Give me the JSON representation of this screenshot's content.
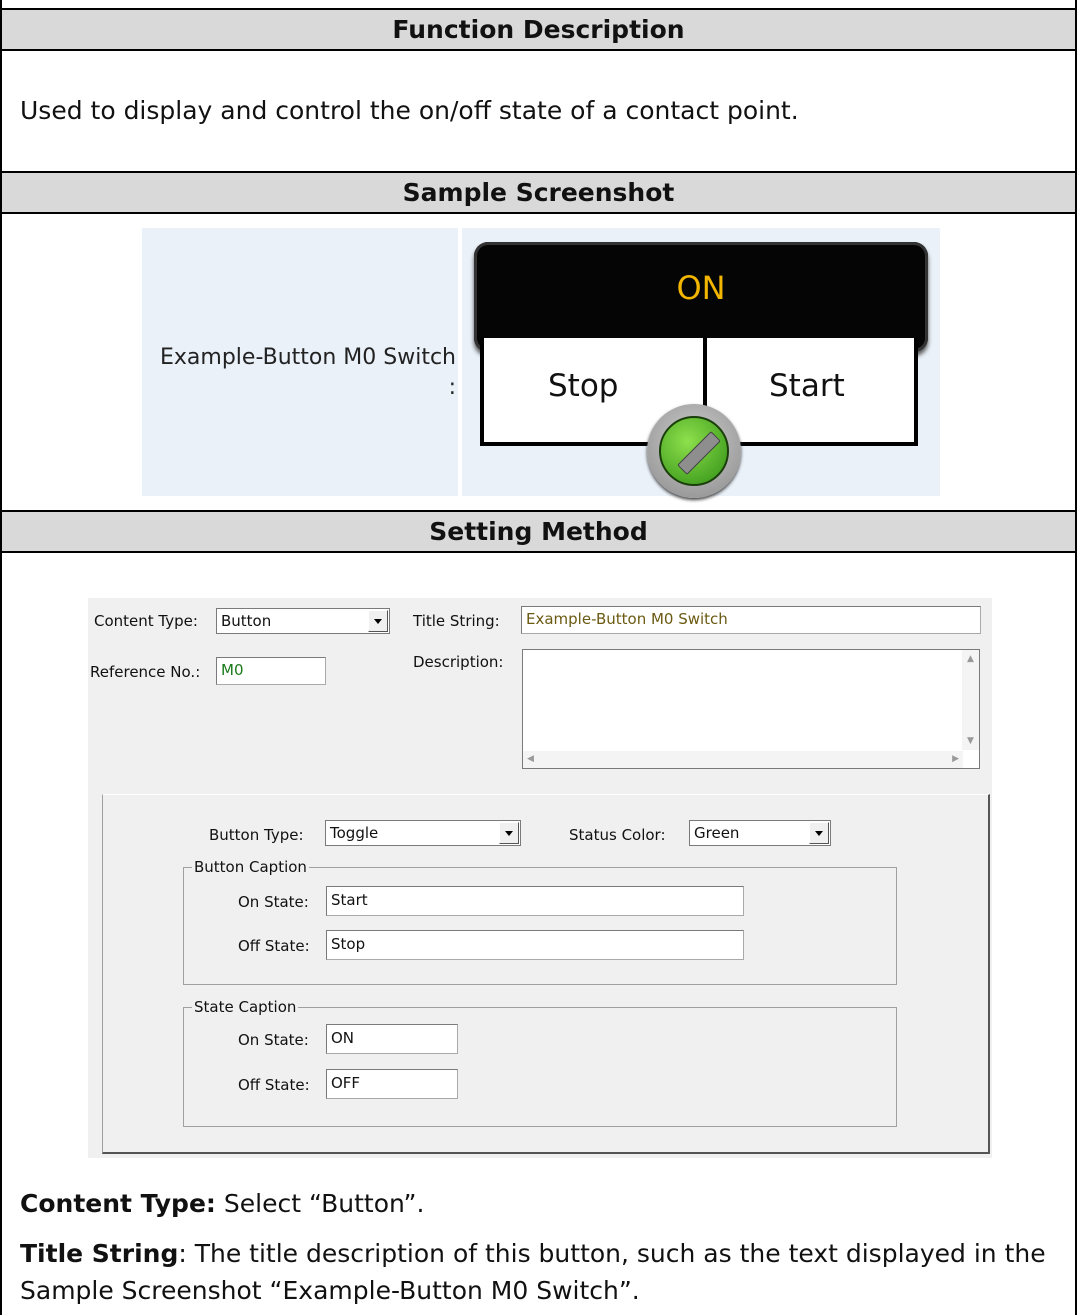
{
  "sections": {
    "function_header": "Function Description",
    "function_text": "Used to display and control the on/off state of a contact point.",
    "sample_header": "Sample Screenshot",
    "setting_header": "Setting Method"
  },
  "sample": {
    "label": "Example-Button M0 Switch",
    "colon": ":",
    "state_caption": "ON",
    "off_label": "Stop",
    "on_label": "Start",
    "knob_color": "#3fa71d"
  },
  "dialog": {
    "content_type_label": "Content Type:",
    "content_type_value": "Button",
    "title_string_label": "Title String:",
    "title_string_value": "Example-Button M0 Switch",
    "reference_label": "Reference No.:",
    "reference_value": "M0",
    "description_label": "Description:",
    "description_value": "",
    "button_type_label": "Button Type:",
    "button_type_value": "Toggle",
    "status_color_label": "Status Color:",
    "status_color_value": "Green",
    "button_caption_title": "Button Caption",
    "button_caption_on_label": "On State:",
    "button_caption_on_value": "Start",
    "button_caption_off_label": "Off State:",
    "button_caption_off_value": "Stop",
    "state_caption_title": "State Caption",
    "state_caption_on_label": "On State:",
    "state_caption_on_value": "ON",
    "state_caption_off_label": "Off State:",
    "state_caption_off_value": "OFF"
  },
  "notes": {
    "content_type_term": "Content Type:",
    "content_type_text": " Select “Button”.",
    "title_string_term": "Title String",
    "title_string_text": ": The title description of this button, such as the text displayed in the Sample Screenshot “Example-Button M0 Switch”."
  },
  "colors": {
    "title_text": "#6b5a12",
    "reference_text": "#1a7a1a",
    "state_caption_color": "#f2b500"
  }
}
